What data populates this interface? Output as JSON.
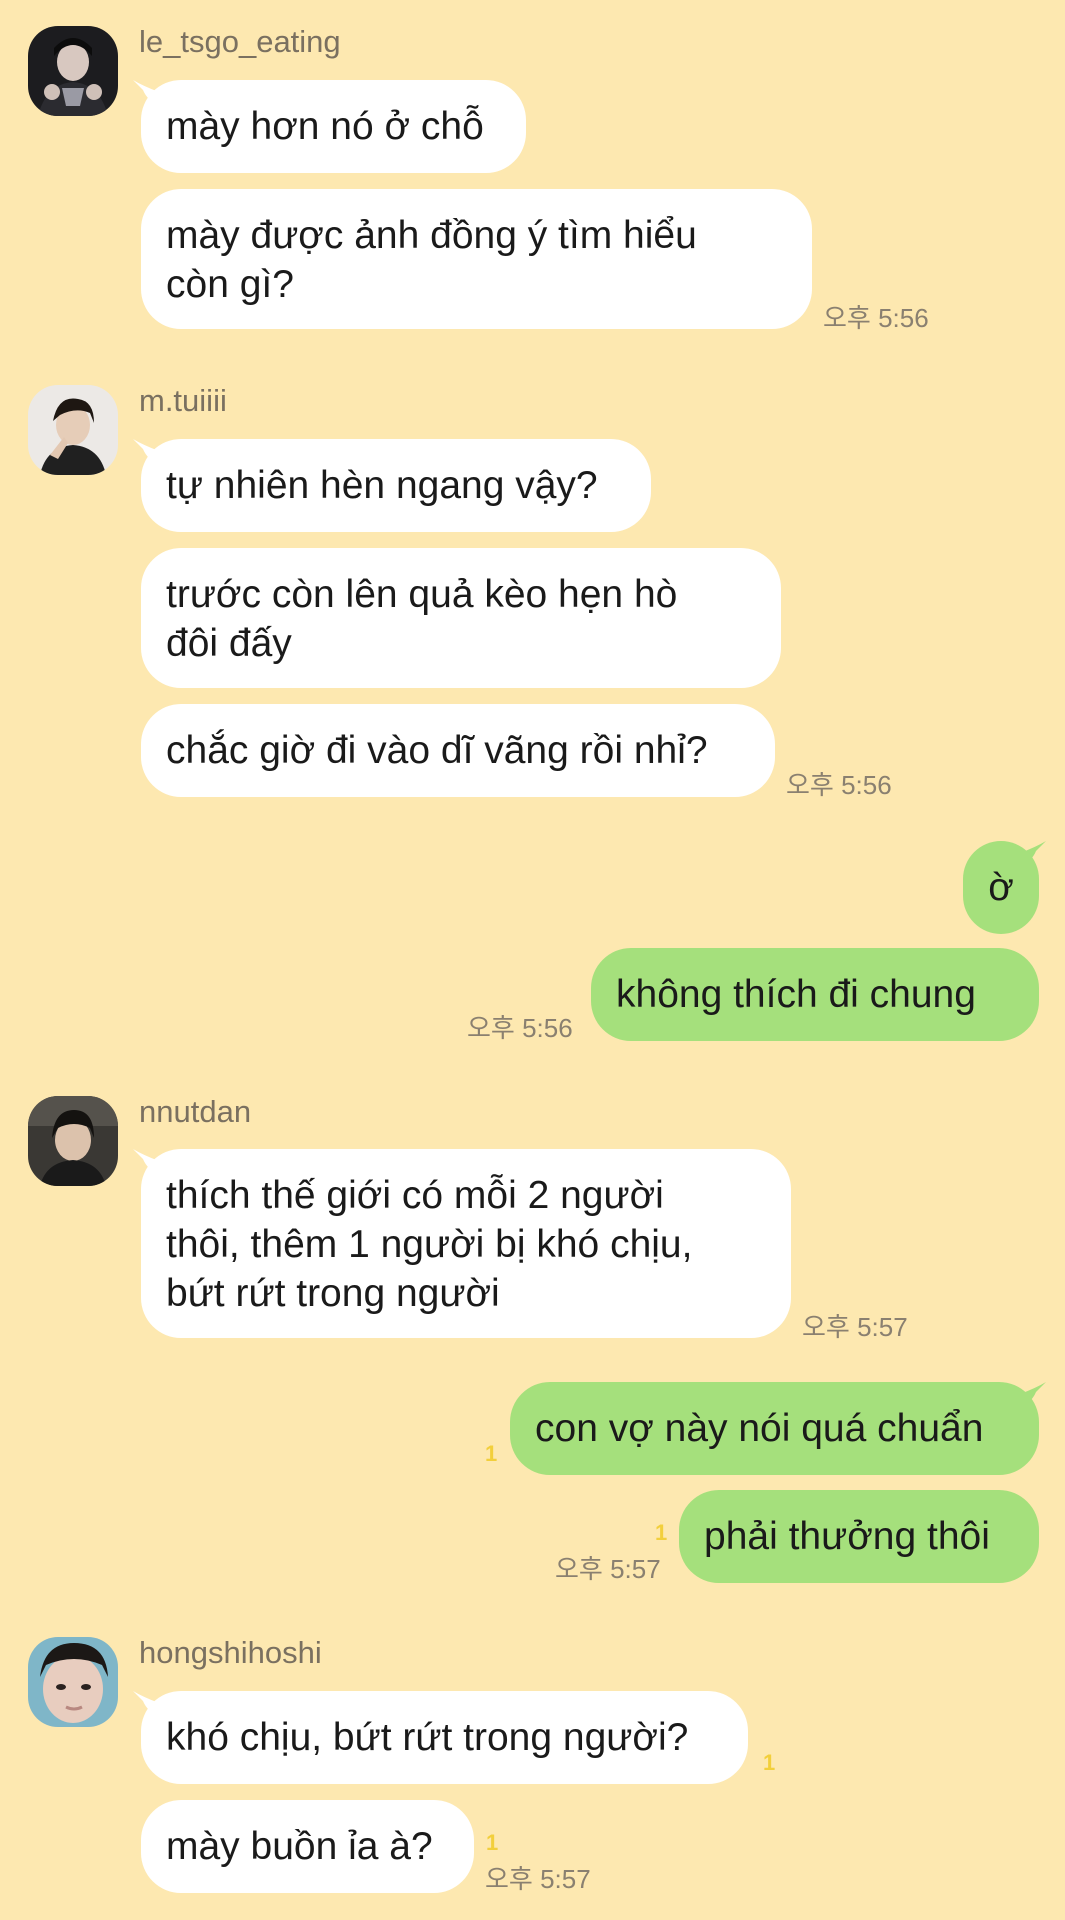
{
  "colors": {
    "background": "#fde8b0",
    "incoming_bubble": "#ffffff",
    "outgoing_bubble": "#a5e07c",
    "unread_indicator": "#f2cf3c"
  },
  "groups": [
    {
      "sender": "le_tsgo_eating",
      "messages": [
        "mày hơn nó ở chỗ",
        "mày được ảnh đồng ý tìm hiểu còn gì?"
      ],
      "time": "오후 5:56"
    },
    {
      "sender": "m.tuiiii",
      "messages": [
        "tự nhiên hèn ngang vậy?",
        "trước còn lên quả kèo hẹn hò đôi đấy",
        "chắc giờ đi vào dĩ vãng rồi nhỉ?"
      ],
      "time": "오후 5:56"
    },
    {
      "sender": "me",
      "messages": [
        "ờ",
        "không thích đi chung"
      ],
      "time": "오후 5:56"
    },
    {
      "sender": "nnutdan",
      "messages": [
        "thích thế giới có mỗi 2 người thôi, thêm 1 người bị khó chịu, bứt rứt trong người"
      ],
      "time": "오후 5:57"
    },
    {
      "sender": "me",
      "messages": [
        "con vợ này nói quá chuẩn",
        "phải thưởng thôi"
      ],
      "unread": [
        "1",
        "1"
      ],
      "time": "오후 5:57"
    },
    {
      "sender": "hongshihoshi",
      "messages": [
        "khó chịu, bứt rứt trong người?",
        "mày buồn ỉa à?"
      ],
      "unread": [
        "1",
        "1"
      ],
      "time": "오후 5:57"
    }
  ],
  "msg_lines": {
    "g0m1": [
      "mày được ảnh đồng ý tìm hiểu",
      "còn gì?"
    ],
    "g1m1": [
      "trước còn lên quả kèo hẹn hò",
      "đôi đấy"
    ],
    "g3m0": [
      "thích thế giới có mỗi 2 người",
      "thôi, thêm 1 người bị khó chịu,",
      "bứt rứt trong người"
    ]
  }
}
